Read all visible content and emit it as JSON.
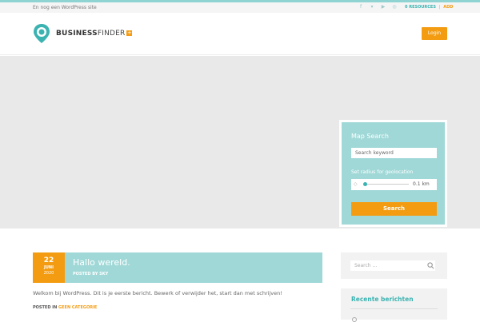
{
  "topbar": {
    "tagline": "En nog een WordPress site",
    "social_icons": [
      "facebook-icon",
      "twitter-icon",
      "youtube-icon",
      "instagram-icon"
    ],
    "resources_label": "0 RESOURCES",
    "separator": "|",
    "add_label": "ADD"
  },
  "header": {
    "logo_bold": "BUSINESS",
    "logo_light": "FINDER",
    "logo_plus": "+",
    "login_label": "Login"
  },
  "map_search": {
    "title": "Map Search",
    "keyword_placeholder": "Search keyword",
    "radius_label": "Set radius for geolocation",
    "radius_value": "0.1 km",
    "radius_fraction": 0.0,
    "search_label": "Search"
  },
  "post": {
    "day": "22",
    "month": "JUNI",
    "year": "2020",
    "title": "Hallo wereld.",
    "meta": "POSTED BY SKY",
    "excerpt": "Welkom bij WordPress. Dit is je eerste bericht. Bewerk of verwijder het, start dan met schrijven!",
    "cats_prefix": "POSTED IN",
    "category": "GEEN CATEGORIE"
  },
  "sidebar": {
    "search_placeholder": "Search ...",
    "recent_heading": "Recente berichten"
  },
  "colors": {
    "accent_teal": "#9fd8d7",
    "accent_orange": "#f39c12",
    "link_teal": "#3bb3b1"
  }
}
